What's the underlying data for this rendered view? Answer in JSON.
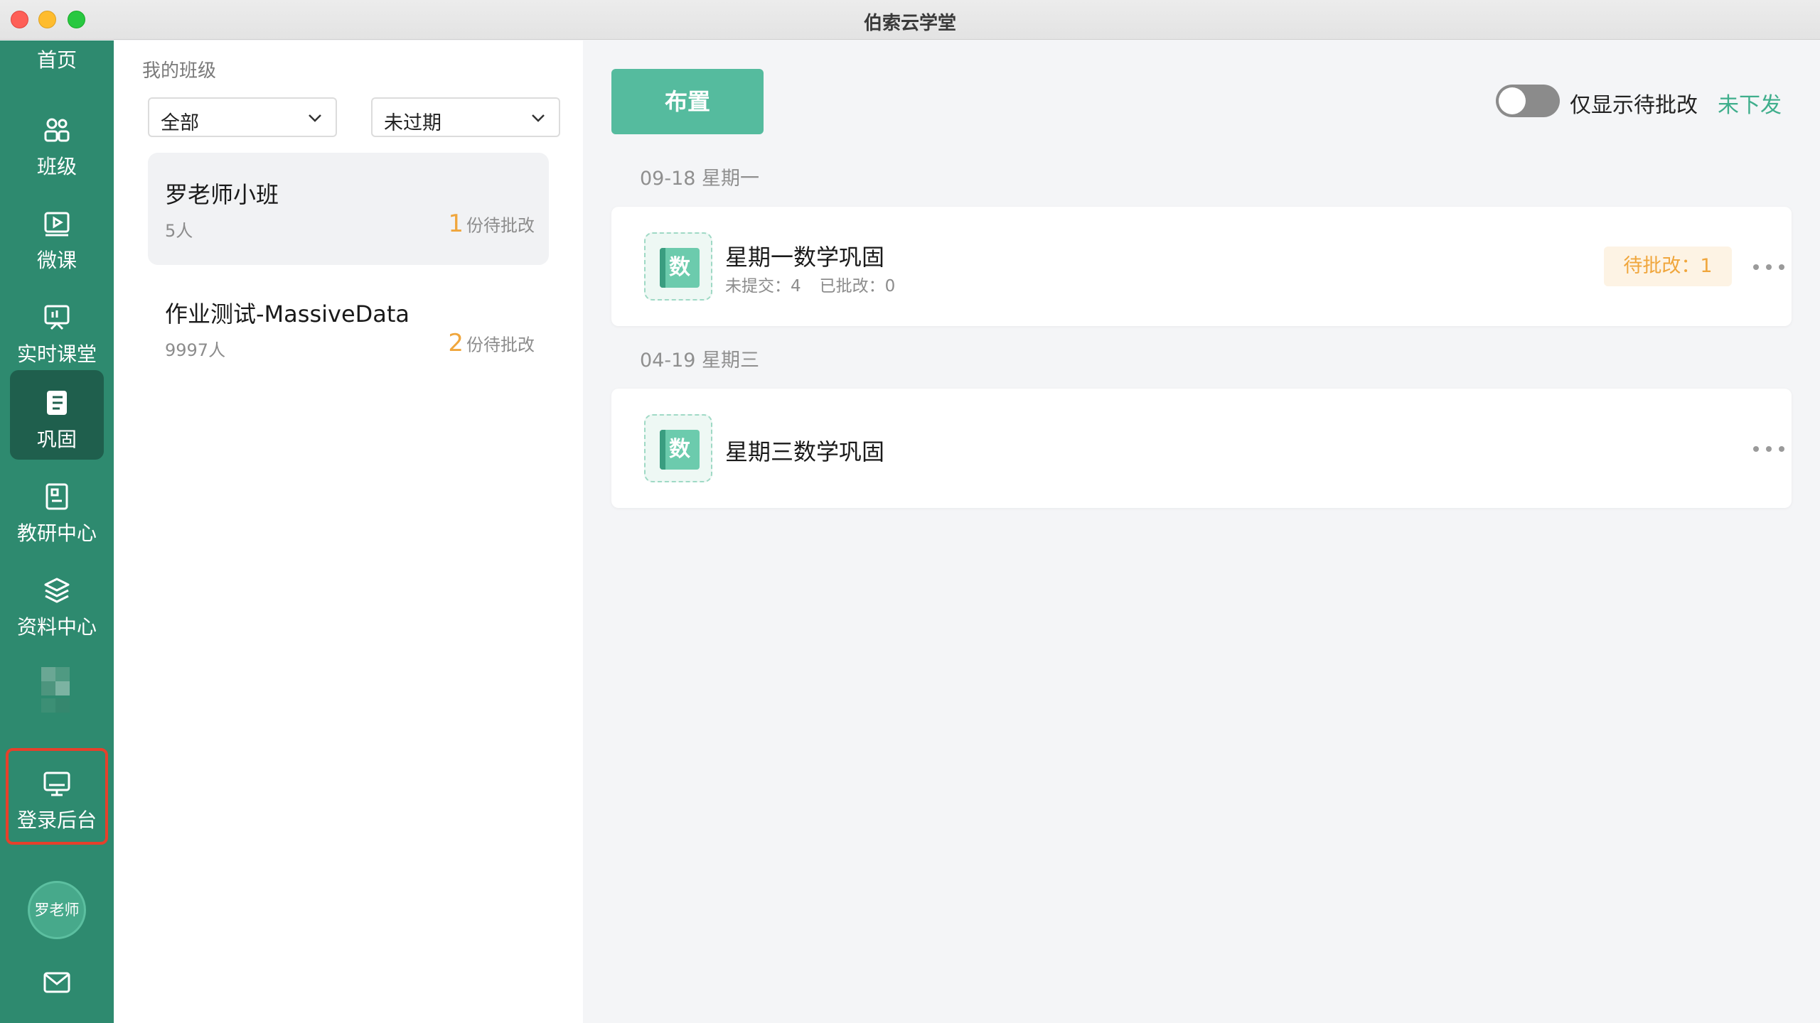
{
  "window": {
    "title": "伯索云学堂"
  },
  "sidebar": {
    "home_label": "首页",
    "items": [
      {
        "label": "班级",
        "icon": "people-icon"
      },
      {
        "label": "微课",
        "icon": "video-icon"
      },
      {
        "label": "实时课堂",
        "icon": "live-class-icon"
      },
      {
        "label": "巩固",
        "icon": "notebook-icon",
        "active": true
      },
      {
        "label": "教研中心",
        "icon": "research-icon"
      },
      {
        "label": "资料中心",
        "icon": "layers-icon"
      }
    ],
    "login_backend_label": "登录后台",
    "avatar_text": "罗老师"
  },
  "class_panel": {
    "title": "我的班级",
    "filter_scope": {
      "value": "全部"
    },
    "filter_status": {
      "value": "未过期"
    },
    "classes": [
      {
        "name": "罗老师小班",
        "count": "5人",
        "pending_num": "1",
        "pending_text": "份待批改",
        "active": true
      },
      {
        "name": "作业测试-MassiveData",
        "count": "9997人",
        "pending_num": "2",
        "pending_text": "份待批改",
        "active": false
      }
    ]
  },
  "main": {
    "assign_button": "布置",
    "toggle_label": "仅显示待批改",
    "toggle_on": false,
    "undistributed_link": "未下发",
    "groups": [
      {
        "date": "09-18  星期一",
        "assignments": [
          {
            "icon_char": "数",
            "title": "星期一数学巩固",
            "not_submitted": "未提交：4",
            "graded": "已批改：0",
            "badge": "待批改：1"
          }
        ]
      },
      {
        "date": "04-19  星期三",
        "assignments": [
          {
            "icon_char": "数",
            "title": "星期三数学巩固"
          }
        ]
      }
    ]
  },
  "colors": {
    "sidebar_bg": "#2e8a6f",
    "sidebar_active": "#1f5f4d",
    "accent_green": "#55bb9e",
    "pending_orange": "#f0a63c",
    "highlight_red": "#e5402b"
  }
}
